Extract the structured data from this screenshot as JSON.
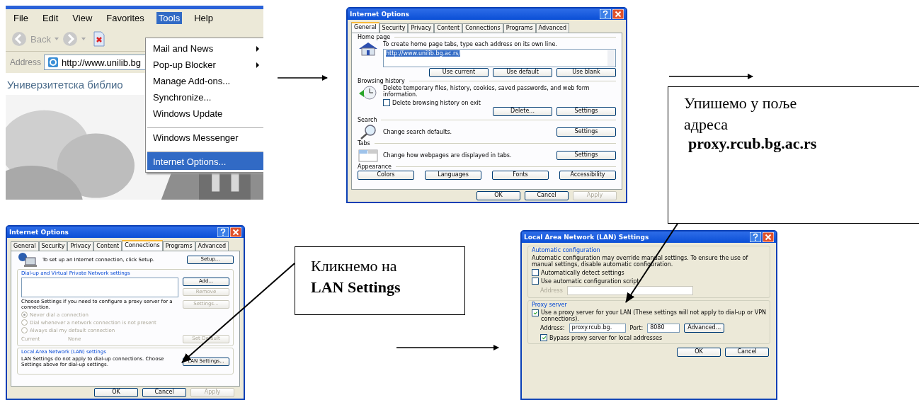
{
  "browser": {
    "menu_bar": [
      {
        "label": "File",
        "selected": false
      },
      {
        "label": "Edit",
        "selected": false
      },
      {
        "label": "View",
        "selected": false
      },
      {
        "label": "Favorites",
        "selected": false
      },
      {
        "label": "Tools",
        "selected": true
      },
      {
        "label": "Help",
        "selected": false
      }
    ],
    "back_label": "Back",
    "address_label": "Address",
    "url": "http://www.unilib.bg",
    "page_heading": "Универзитетска библио",
    "tools_menu": [
      {
        "label": "Mail and News",
        "submenu": true,
        "separator_before": false,
        "selected": false
      },
      {
        "label": "Pop-up Blocker",
        "submenu": true,
        "separator_before": false,
        "selected": false
      },
      {
        "label": "Manage Add-ons...",
        "submenu": false,
        "separator_before": false,
        "selected": false
      },
      {
        "label": "Synchronize...",
        "submenu": false,
        "separator_before": false,
        "selected": false
      },
      {
        "label": "Windows Update",
        "submenu": false,
        "separator_before": false,
        "selected": false
      },
      {
        "label": "Windows Messenger",
        "submenu": false,
        "separator_before": true,
        "selected": false
      },
      {
        "label": "Internet Options...",
        "submenu": false,
        "separator_before": true,
        "selected": true
      }
    ]
  },
  "general_dialog": {
    "title": "Internet Options",
    "tabs": [
      {
        "label": "General",
        "selected": true
      },
      {
        "label": "Security",
        "selected": false
      },
      {
        "label": "Privacy",
        "selected": false
      },
      {
        "label": "Content",
        "selected": false
      },
      {
        "label": "Connections",
        "selected": false
      },
      {
        "label": "Programs",
        "selected": false
      },
      {
        "label": "Advanced",
        "selected": false
      }
    ],
    "home_page": {
      "heading": "Home page",
      "hint": "To create home page tabs, type each address on its own line.",
      "value": "http://www.unilib.bg.ac.rs/",
      "buttons": [
        "Use current",
        "Use default",
        "Use blank"
      ]
    },
    "history": {
      "heading": "Browsing history",
      "text": "Delete temporary files, history, cookies, saved passwords, and web form information.",
      "checkbox": {
        "label": "Delete browsing history on exit",
        "checked": false
      },
      "buttons": [
        "Delete...",
        "Settings"
      ]
    },
    "search": {
      "heading": "Search",
      "text": "Change search defaults.",
      "button": "Settings"
    },
    "tabs_section": {
      "heading": "Tabs",
      "text": "Change how webpages are displayed in tabs.",
      "button": "Settings"
    },
    "appearance": {
      "heading": "Appearance",
      "buttons": [
        "Colors",
        "Languages",
        "Fonts",
        "Accessibility"
      ]
    },
    "footer": [
      {
        "label": "OK",
        "disabled": false
      },
      {
        "label": "Cancel",
        "disabled": false
      },
      {
        "label": "Apply",
        "disabled": true
      }
    ]
  },
  "connections_dialog": {
    "title": "Internet Options",
    "tabs": [
      {
        "label": "General",
        "selected": false
      },
      {
        "label": "Security",
        "selected": false
      },
      {
        "label": "Privacy",
        "selected": false
      },
      {
        "label": "Content",
        "selected": false
      },
      {
        "label": "Connections",
        "selected": true
      },
      {
        "label": "Programs",
        "selected": false
      },
      {
        "label": "Advanced",
        "selected": false
      }
    ],
    "setup_text": "To set up an Internet connection, click Setup.",
    "setup_button": "Setup...",
    "dialup": {
      "heading": "Dial-up and Virtual Private Network settings",
      "add_button": {
        "label": "Add...",
        "disabled": false
      },
      "remove_button": {
        "label": "Remove",
        "disabled": true
      },
      "text": "Choose Settings if you need to configure a proxy server for a connection.",
      "settings_button": {
        "label": "Settings...",
        "disabled": true
      },
      "radios": [
        {
          "label": "Never dial a connection",
          "selected": true
        },
        {
          "label": "Dial whenever a network connection is not present",
          "selected": false
        },
        {
          "label": "Always dial my default connection",
          "selected": false
        }
      ],
      "current_label": "Current",
      "current_value": "None",
      "default_button": {
        "label": "Set Default",
        "disabled": true
      }
    },
    "lan": {
      "heading": "Local Area Network (LAN) settings",
      "text": "LAN Settings do not apply to dial-up connections. Choose Settings above for dial-up settings.",
      "button": "LAN Settings..."
    },
    "footer": [
      {
        "label": "OK",
        "disabled": false
      },
      {
        "label": "Cancel",
        "disabled": false
      },
      {
        "label": "Apply",
        "disabled": true
      }
    ]
  },
  "lan_dialog": {
    "title": "Local Area Network (LAN) Settings",
    "auto": {
      "heading": "Automatic configuration",
      "text": "Automatic configuration may override manual settings.  To ensure the use of manual settings, disable automatic configuration.",
      "checkboxes": [
        {
          "label": "Automatically detect settings",
          "checked": false
        },
        {
          "label": "Use automatic configuration script",
          "checked": false
        }
      ],
      "address_label": "Address"
    },
    "proxy": {
      "heading": "Proxy server",
      "checkbox": {
        "label": "Use a proxy server for your LAN (These settings will not apply to dial-up or VPN connections).",
        "checked": true
      },
      "address_label": "Address:",
      "address_value": "proxy.rcub.bg.",
      "port_label": "Port:",
      "port_value": "8080",
      "advanced_button": "Advanced...",
      "bypass": {
        "label": "Bypass proxy server for local addresses",
        "checked": true
      }
    },
    "footer": [
      "OK",
      "Cancel"
    ]
  },
  "callouts": [
    {
      "text": "Упишемо у поље адреса",
      "bold_text": "proxy.rcub.bg.ac.rs"
    },
    {
      "text": "Кликнемо на",
      "bold_text": "LAN Settings"
    }
  ]
}
